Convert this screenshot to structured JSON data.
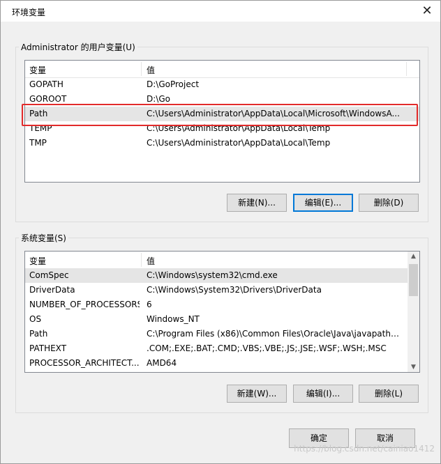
{
  "window": {
    "title": "环境变量",
    "close_glyph": "✕"
  },
  "user_vars": {
    "group_label": "Administrator 的用户变量(U)",
    "col_name": "变量",
    "col_value": "值",
    "rows": [
      {
        "name": "GOPATH",
        "value": "D:\\GoProject"
      },
      {
        "name": "GOROOT",
        "value": "D:\\Go"
      },
      {
        "name": "Path",
        "value": "C:\\Users\\Administrator\\AppData\\Local\\Microsoft\\WindowsA..."
      },
      {
        "name": "TEMP",
        "value": "C:\\Users\\Administrator\\AppData\\Local\\Temp"
      },
      {
        "name": "TMP",
        "value": "C:\\Users\\Administrator\\AppData\\Local\\Temp"
      }
    ],
    "buttons": {
      "new": "新建(N)...",
      "edit": "编辑(E)...",
      "delete": "删除(D)"
    }
  },
  "system_vars": {
    "group_label": "系统变量(S)",
    "col_name": "变量",
    "col_value": "值",
    "rows": [
      {
        "name": "ComSpec",
        "value": "C:\\Windows\\system32\\cmd.exe"
      },
      {
        "name": "DriverData",
        "value": "C:\\Windows\\System32\\Drivers\\DriverData"
      },
      {
        "name": "NUMBER_OF_PROCESSORS",
        "value": "6"
      },
      {
        "name": "OS",
        "value": "Windows_NT"
      },
      {
        "name": "Path",
        "value": "C:\\Program Files (x86)\\Common Files\\Oracle\\Java\\javapath;C:..."
      },
      {
        "name": "PATHEXT",
        "value": ".COM;.EXE;.BAT;.CMD;.VBS;.VBE;.JS;.JSE;.WSF;.WSH;.MSC"
      },
      {
        "name": "PROCESSOR_ARCHITECT...",
        "value": "AMD64"
      }
    ],
    "buttons": {
      "new": "新建(W)...",
      "edit": "编辑(I)...",
      "delete": "删除(L)"
    }
  },
  "footer": {
    "ok": "确定",
    "cancel": "取消"
  },
  "watermark": "https://blog.csdn.net/cainiao1412",
  "colors": {
    "highlight": "#e22a2a",
    "focus": "#0078d7"
  }
}
